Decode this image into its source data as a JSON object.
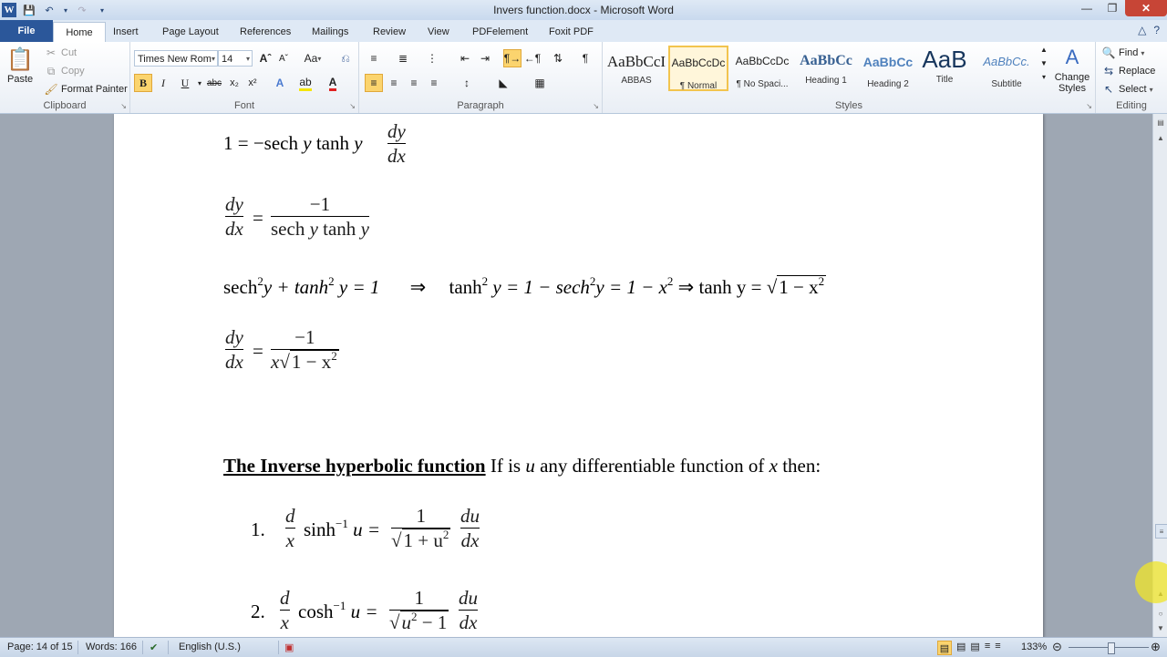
{
  "window": {
    "title": "Invers function.docx - Microsoft Word",
    "app_icon": "W"
  },
  "tabs": [
    "File",
    "Home",
    "Insert",
    "Page Layout",
    "References",
    "Mailings",
    "Review",
    "View",
    "PDFelement",
    "Foxit PDF"
  ],
  "ribbon": {
    "clipboard": {
      "paste": "Paste",
      "cut": "Cut",
      "copy": "Copy",
      "format_painter": "Format Painter",
      "label": "Clipboard"
    },
    "font": {
      "name": "Times New Rom",
      "size": "14",
      "label": "Font",
      "bold": "B",
      "italic": "I",
      "underline": "U",
      "strike": "abc"
    },
    "paragraph": {
      "label": "Paragraph"
    },
    "styles": {
      "label": "Styles",
      "items": [
        {
          "preview": "AaBbCcI",
          "name": "ABBAS"
        },
        {
          "preview": "AaBbCcDc",
          "name": "¶ Normal"
        },
        {
          "preview": "AaBbCcDc",
          "name": "¶ No Spaci..."
        },
        {
          "preview": "AaBbCc",
          "name": "Heading 1"
        },
        {
          "preview": "AaBbCc",
          "name": "Heading 2"
        },
        {
          "preview": "AaB",
          "name": "Title"
        },
        {
          "preview": "AaBbCc.",
          "name": "Subtitle"
        }
      ],
      "change_styles": "Change Styles"
    },
    "editing": {
      "find": "Find",
      "replace": "Replace",
      "select": "Select",
      "label": "Editing"
    }
  },
  "document": {
    "line1": {
      "lhs": "1 = −sech",
      "y1": "y",
      "mid": "tanh",
      "y2": "y",
      "frac_num": "dy",
      "frac_den": "dx"
    },
    "line2": {
      "num": "dy",
      "den": "dx",
      "rhs_num": "−1",
      "rhs_den_a": "sech",
      "rhs_den_b": "y",
      "rhs_den_c": "tanh",
      "rhs_den_d": "y"
    },
    "line3": {
      "text_a": "sech",
      "text_b": "y + tanh",
      "text_c": "y = 1",
      "arrow1": "⇒",
      "text_d": "tanh",
      "text_e": "y = 1 − sech",
      "text_f": "y = 1 − x",
      "arrow2": "⇒",
      "text_g": "tanh y =",
      "sqrt": "1 − x"
    },
    "line4": {
      "num": "dy",
      "den": "dx",
      "rhs_num": "−1",
      "rhs_den_x": "x",
      "rhs_den_sqrt": "1 − x"
    },
    "heading": "The Inverse hyperbolic function",
    "heading_rest_a": "If is",
    "heading_var_u": "u",
    "heading_rest_b": "any differentiable function of",
    "heading_var_x": "x",
    "heading_rest_c": "then:",
    "item1": {
      "num": "1.",
      "d_num": "d",
      "d_den": "x",
      "func": "sinh",
      "exp": "−1",
      "var": "u =",
      "f_num": "1",
      "f_den": "1 + u",
      "du_num": "du",
      "du_den": "dx"
    },
    "item2": {
      "num": "2.",
      "d_num": "d",
      "d_den": "x",
      "func": "cosh",
      "exp": "−1",
      "var": "u =",
      "f_num": "1",
      "f_den": "u",
      "f_den_b": " − 1",
      "du_num": "du",
      "du_den": "dx"
    }
  },
  "statusbar": {
    "page": "Page: 14 of 15",
    "words": "Words: 166",
    "language": "English (U.S.)",
    "zoom": "133%"
  }
}
